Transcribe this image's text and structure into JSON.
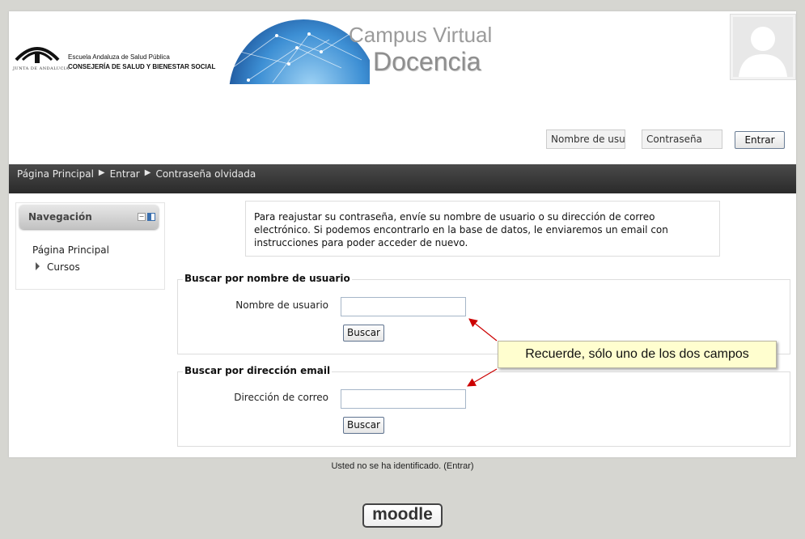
{
  "header": {
    "junta_text": "JUNTA DE ANDALUCIA",
    "escuela": "Escuela Andaluza de Salud Pública",
    "consejeria": "CONSEJERÍA DE SALUD Y BIENESTAR SOCIAL",
    "campus_title": "Campus Virtual",
    "docencia_title": "Docencia"
  },
  "login": {
    "username_placeholder": "Nombre de usu",
    "password_placeholder": "Contraseña",
    "submit_label": "Entrar"
  },
  "breadcrumb": [
    "Página Principal",
    "Entrar",
    "Contraseña olvidada"
  ],
  "navigation": {
    "title": "Navegación",
    "items": [
      {
        "label": "Página Principal"
      },
      {
        "label": "Cursos"
      }
    ]
  },
  "intro": "Para reajustar su contraseña, envíe su nombre de usuario o su dirección de correo electrónico. Si podemos encontrarlo en la base de datos, le enviaremos un email con instrucciones para poder acceder de nuevo.",
  "search_username": {
    "legend": "Buscar por nombre de usuario",
    "label": "Nombre de usuario",
    "button": "Buscar"
  },
  "search_email": {
    "legend": "Buscar por dirección email",
    "label": "Dirección de correo",
    "button": "Buscar"
  },
  "callout": "Recuerde, sólo uno de los dos campos",
  "footer": {
    "status": "Usted no se ha identificado. (Entrar)",
    "logo_text": "moodle"
  },
  "colors": {
    "navbar": "#3a3a3a",
    "callout_bg": "#fffecf",
    "arrow": "#cc0000",
    "background": "#d6d6d1"
  }
}
